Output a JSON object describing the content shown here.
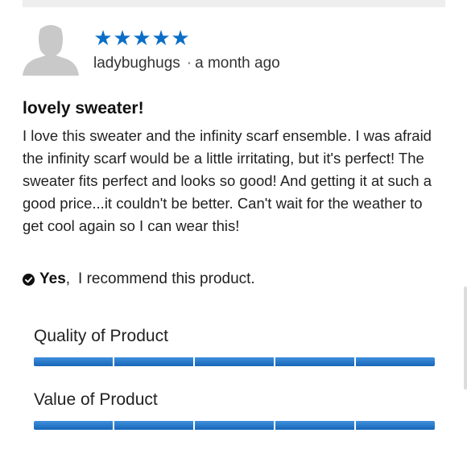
{
  "review": {
    "rating": 5,
    "rating_max": 5,
    "star_glyph": "★",
    "author": "ladybughugs",
    "separator": "·",
    "date": "a month ago",
    "title": "lovely sweater!",
    "body": "I love this sweater and the infinity scarf ensemble. I was afraid the infinity scarf would be a little irritating, but it's perfect! The sweater fits perfect and looks so good! And getting it at such a good price...it couldn't be better. Can't wait for the weather to get cool again so I can wear this!",
    "recommend": {
      "answer": "Yes",
      "comma": ",",
      "text": "I recommend this product."
    },
    "ratings": [
      {
        "label": "Quality of Product",
        "value": 5,
        "max": 5
      },
      {
        "label": "Value of Product",
        "value": 5,
        "max": 5
      }
    ]
  },
  "colors": {
    "star": "#0a6ec8",
    "bar_fill": "#1b6ec4",
    "bar_empty": "#dddddd",
    "avatar": "#c9c9c9"
  },
  "icons": {
    "avatar": "user-silhouette-icon",
    "recommend": "check-circle-icon"
  }
}
